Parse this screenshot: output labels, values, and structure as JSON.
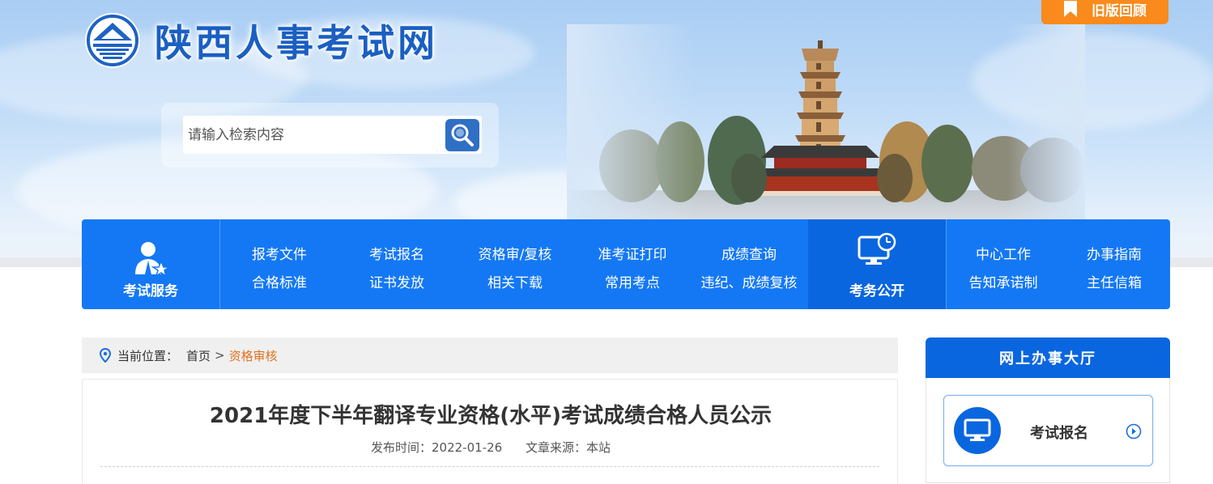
{
  "header": {
    "site_title": "陕西人事考试网",
    "old_version_label": "旧版回顾"
  },
  "search": {
    "placeholder": "请输入检索内容"
  },
  "nav": {
    "service_title": "考试服务",
    "service_links_row1": [
      "报考文件",
      "考试报名",
      "资格审/复核",
      "准考证打印",
      "成绩查询"
    ],
    "service_links_row2": [
      "合格标准",
      "证书发放",
      "相关下载",
      "常用考点",
      "违纪、成绩复核"
    ],
    "public_title": "考务公开",
    "public_links_row1": [
      "中心工作",
      "办事指南"
    ],
    "public_links_row2": [
      "告知承诺制",
      "主任信箱"
    ]
  },
  "breadcrumb": {
    "label": "当前位置：",
    "home": "首页",
    "separator": ">",
    "current": "资格审核"
  },
  "article": {
    "title": "2021年度下半年翻译专业资格(水平)考试成绩合格人员公示",
    "publish_label": "发布时间：2022-01-26",
    "source_label": "文章来源：本站"
  },
  "sidebar": {
    "title": "网上办事大厅",
    "card_label": "考试报名"
  },
  "colors": {
    "nav_blue": "#1478f5",
    "nav_dark_blue": "#0a66df",
    "accent_orange": "#f98a1b",
    "breadcrumb_current": "#e2711d"
  }
}
